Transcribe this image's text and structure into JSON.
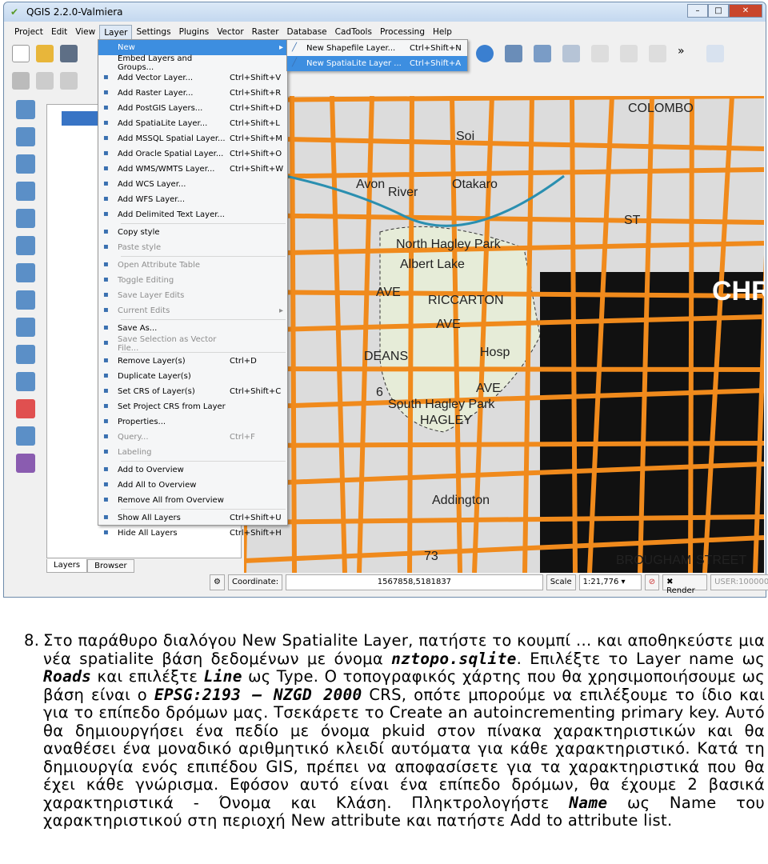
{
  "window": {
    "title": "QGIS 2.2.0-Valmiera",
    "min": "–",
    "max": "□",
    "close": "✕"
  },
  "menubar": [
    "Project",
    "Edit",
    "View",
    "Layer",
    "Settings",
    "Plugins",
    "Vector",
    "Raster",
    "Database",
    "CadTools",
    "Processing",
    "Help"
  ],
  "layer_menu": [
    {
      "label": "New",
      "shortcut": "",
      "state": "highlight",
      "arrow": "▸"
    },
    {
      "label": "Embed Layers and Groups...",
      "shortcut": ""
    },
    {
      "label": "Add Vector Layer...",
      "shortcut": "Ctrl+Shift+V"
    },
    {
      "label": "Add Raster Layer...",
      "shortcut": "Ctrl+Shift+R"
    },
    {
      "label": "Add PostGIS Layers...",
      "shortcut": "Ctrl+Shift+D"
    },
    {
      "label": "Add SpatiaLite Layer...",
      "shortcut": "Ctrl+Shift+L"
    },
    {
      "label": "Add MSSQL Spatial Layer...",
      "shortcut": "Ctrl+Shift+M"
    },
    {
      "label": "Add Oracle Spatial Layer...",
      "shortcut": "Ctrl+Shift+O"
    },
    {
      "label": "Add WMS/WMTS Layer...",
      "shortcut": "Ctrl+Shift+W"
    },
    {
      "label": "Add WCS Layer...",
      "shortcut": ""
    },
    {
      "label": "Add WFS Layer...",
      "shortcut": ""
    },
    {
      "label": "Add Delimited Text Layer...",
      "shortcut": "",
      "sep_after": true
    },
    {
      "label": "Copy style",
      "shortcut": ""
    },
    {
      "label": "Paste style",
      "shortcut": "",
      "state": "disabled",
      "sep_after": true
    },
    {
      "label": "Open Attribute Table",
      "shortcut": "",
      "state": "disabled"
    },
    {
      "label": "Toggle Editing",
      "shortcut": "",
      "state": "disabled"
    },
    {
      "label": "Save Layer Edits",
      "shortcut": "",
      "state": "disabled"
    },
    {
      "label": "Current Edits",
      "shortcut": "",
      "state": "disabled",
      "arrow": "▸",
      "sep_after": true
    },
    {
      "label": "Save As...",
      "shortcut": ""
    },
    {
      "label": "Save Selection as Vector File...",
      "shortcut": "",
      "state": "disabled",
      "sep_after": true
    },
    {
      "label": "Remove Layer(s)",
      "shortcut": "Ctrl+D"
    },
    {
      "label": "Duplicate Layer(s)",
      "shortcut": ""
    },
    {
      "label": "Set CRS of Layer(s)",
      "shortcut": "Ctrl+Shift+C"
    },
    {
      "label": "Set Project CRS from Layer",
      "shortcut": ""
    },
    {
      "label": "Properties...",
      "shortcut": ""
    },
    {
      "label": "Query...",
      "shortcut": "Ctrl+F",
      "state": "disabled"
    },
    {
      "label": "Labeling",
      "shortcut": "",
      "state": "disabled",
      "sep_after": true
    },
    {
      "label": "Add to Overview",
      "shortcut": ""
    },
    {
      "label": "Add All to Overview",
      "shortcut": ""
    },
    {
      "label": "Remove All from Overview",
      "shortcut": "",
      "sep_after": true
    },
    {
      "label": "Show All Layers",
      "shortcut": "Ctrl+Shift+U"
    },
    {
      "label": "Hide All Layers",
      "shortcut": "Ctrl+Shift+H"
    }
  ],
  "new_submenu": [
    {
      "label": "New Shapefile Layer...",
      "shortcut": "Ctrl+Shift+N"
    },
    {
      "label": "New SpatiaLite Layer ...",
      "shortcut": "Ctrl+Shift+A",
      "state": "highlight"
    }
  ],
  "layers_panel": {
    "tabs": [
      "Layers",
      "Browser"
    ],
    "active": "Layers"
  },
  "map": {
    "labels": [
      "Soi",
      "Avon",
      "River",
      "Otakaro",
      "North Hagley Park",
      "Albert Lake",
      "DEANS",
      "AVE",
      "RICCARTON",
      "AVE",
      "Hosp",
      "South Hagley Park",
      "HAGLEY",
      "AVE",
      "Addington",
      "73",
      "COLOMBO",
      "ST",
      "CHR",
      "BROUGHAM",
      "STREET",
      "6"
    ],
    "road_color": "#f08a1c"
  },
  "status": {
    "coordinate_label": "Coordinate:",
    "coordinate": "1567858,5181837",
    "scale_label": "Scale",
    "scale": "1:21,776",
    "render_label": "Render",
    "render_checked": true,
    "crs": "USER:100000"
  },
  "doc": {
    "number": "8.",
    "segments": [
      {
        "t": "Στο παράθυρο διαλόγου New Spatialite Layer, πατήστε το κουμπί ... και αποθηκεύστε μια νέα spatialite βάση δεδομένων με όνομα "
      },
      {
        "t": "nztopo.sqlite",
        "code": true
      },
      {
        "t": ". Επιλέξτε το Layer name ως "
      },
      {
        "t": "Roads",
        "code": true
      },
      {
        "t": " και επιλέξτε "
      },
      {
        "t": "Line",
        "code": true
      },
      {
        "t": " ως Type. Ο τοπογραφικός χάρτης που θα χρησιμοποιήσουμε ως βάση είναι ο "
      },
      {
        "t": "EPSG:2193 – NZGD 2000",
        "code": true
      },
      {
        "t": " CRS, οπότε μπορούμε να επιλέξουμε το ίδιο και για το επίπεδο δρόμων μας. Τσεκάρετε το Create an autoincrementing primary key. Αυτό θα δημιουργήσει ένα πεδίο με όνομα pkuid στον πίνακα χαρακτηριστικών και θα αναθέσει ένα μοναδικό αριθμητικό κλειδί αυτόματα για κάθε χαρακτηριστικό. Κατά τη δημιουργία ενός επιπέδου GIS, πρέπει να αποφασίσετε για τα χαρακτηριστικά που θα έχει κάθε γνώρισμα. Εφόσον αυτό είναι ένα επίπεδο δρόμων, θα έχουμε 2 βασικά χαρακτηριστικά - Όνομα και Κλάση. Πληκτρολογήστε "
      },
      {
        "t": "Name",
        "code": true
      },
      {
        "t": " ως Name του χαρακτηριστικού στη περιοχή New attribute και πατήστε Add to attribute list."
      }
    ]
  }
}
